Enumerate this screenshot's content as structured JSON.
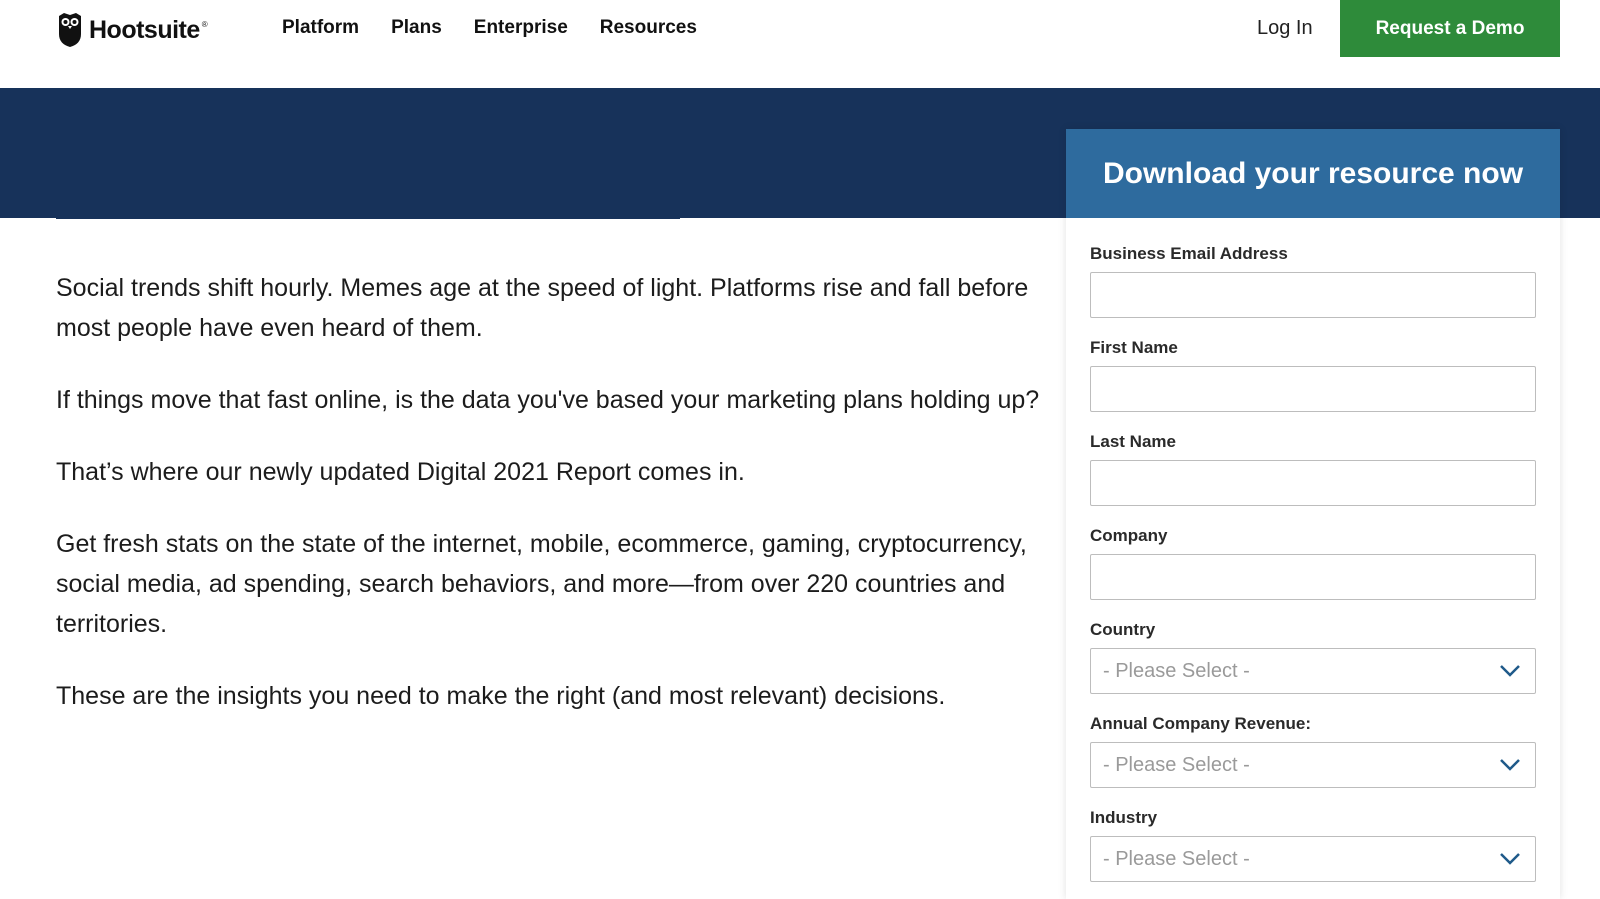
{
  "header": {
    "logo_text": "Hootsuite",
    "logo_reg": "®",
    "nav": [
      {
        "label": "Platform"
      },
      {
        "label": "Plans"
      },
      {
        "label": "Enterprise"
      },
      {
        "label": "Resources"
      }
    ],
    "login_label": "Log In",
    "demo_label": "Request a Demo"
  },
  "content": {
    "paragraphs": [
      "Social trends shift hourly. Memes age at the speed of light. Platforms rise and fall before most people have even heard of them.",
      "If things move that fast online, is the data you've based your marketing plans holding up?",
      "That’s where our newly updated Digital 2021 Report comes in.",
      "Get fresh stats on the state of the internet, mobile, ecommerce, gaming, cryptocurrency, social media, ad spending, search behaviors, and more—from over 220 countries and territories.",
      "These are the insights you need to make the right (and most relevant) decisions."
    ]
  },
  "form": {
    "title": "Download your resource now",
    "fields": [
      {
        "label": "Business Email Address",
        "type": "input",
        "value": ""
      },
      {
        "label": "First Name",
        "type": "input",
        "value": ""
      },
      {
        "label": "Last Name",
        "type": "input",
        "value": ""
      },
      {
        "label": "Company",
        "type": "input",
        "value": ""
      },
      {
        "label": "Country",
        "type": "select",
        "value": "- Please Select -"
      },
      {
        "label": "Annual Company Revenue:",
        "type": "select",
        "value": "- Please Select -"
      },
      {
        "label": "Industry",
        "type": "select",
        "value": "- Please Select -"
      }
    ]
  },
  "colors": {
    "brand_navy": "#17325a",
    "form_header_blue": "#2e6b9e",
    "cta_green": "#2e8b3a"
  },
  "icons": {
    "logo": "owl-logo-icon",
    "select_chevron": "chevron-down-icon"
  }
}
